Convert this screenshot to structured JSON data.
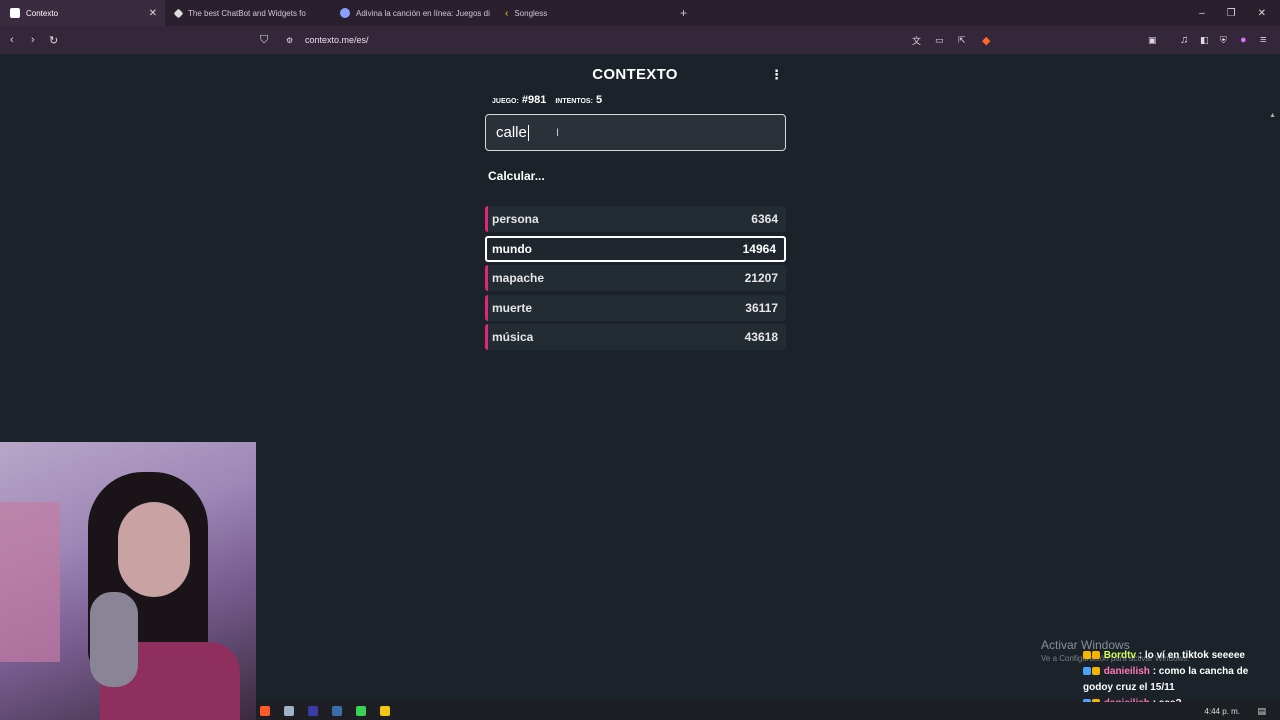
{
  "browser": {
    "tabs": [
      {
        "label": "Contexto",
        "active": true
      },
      {
        "label": "The best ChatBot and Widgets fo",
        "active": false
      },
      {
        "label": "Adivina la canción en línea: Juegos di",
        "active": false
      },
      {
        "label": "Songless",
        "active": false
      }
    ],
    "new_tab": "+",
    "url": "contexto.me/es/",
    "window_controls": {
      "minimize": "–",
      "restore": "❐",
      "close": "✕"
    }
  },
  "game": {
    "title": "CONTEXTO",
    "menu_icon": "⋮",
    "game_label": "JUEGO:",
    "game_number": "#981",
    "attempts_label": "INTENTOS:",
    "attempts": "5",
    "input_value": "calle",
    "status": "Calcular...",
    "accent_color": "#e0257a",
    "guesses": [
      {
        "word": "persona",
        "rank": "6364",
        "selected": false
      },
      {
        "word": "mundo",
        "rank": "14964",
        "selected": true
      },
      {
        "word": "mapache",
        "rank": "21207",
        "selected": false
      },
      {
        "word": "muerte",
        "rank": "36117",
        "selected": false
      },
      {
        "word": "música",
        "rank": "43618",
        "selected": false
      }
    ]
  },
  "overlay": {
    "activate_windows": "Activar Windows",
    "activate_windows_sub": "Ve a Configuración para activar Windows.",
    "chat": [
      {
        "user": "Bordtv",
        "message": ": lo ví en tiktok seeeee"
      },
      {
        "user": "danieilish",
        "message": ": como la cancha de godoy cruz el 15/11"
      },
      {
        "user": "danieilish",
        "message": ": eee?"
      }
    ],
    "clock": "4:44 p. m."
  }
}
